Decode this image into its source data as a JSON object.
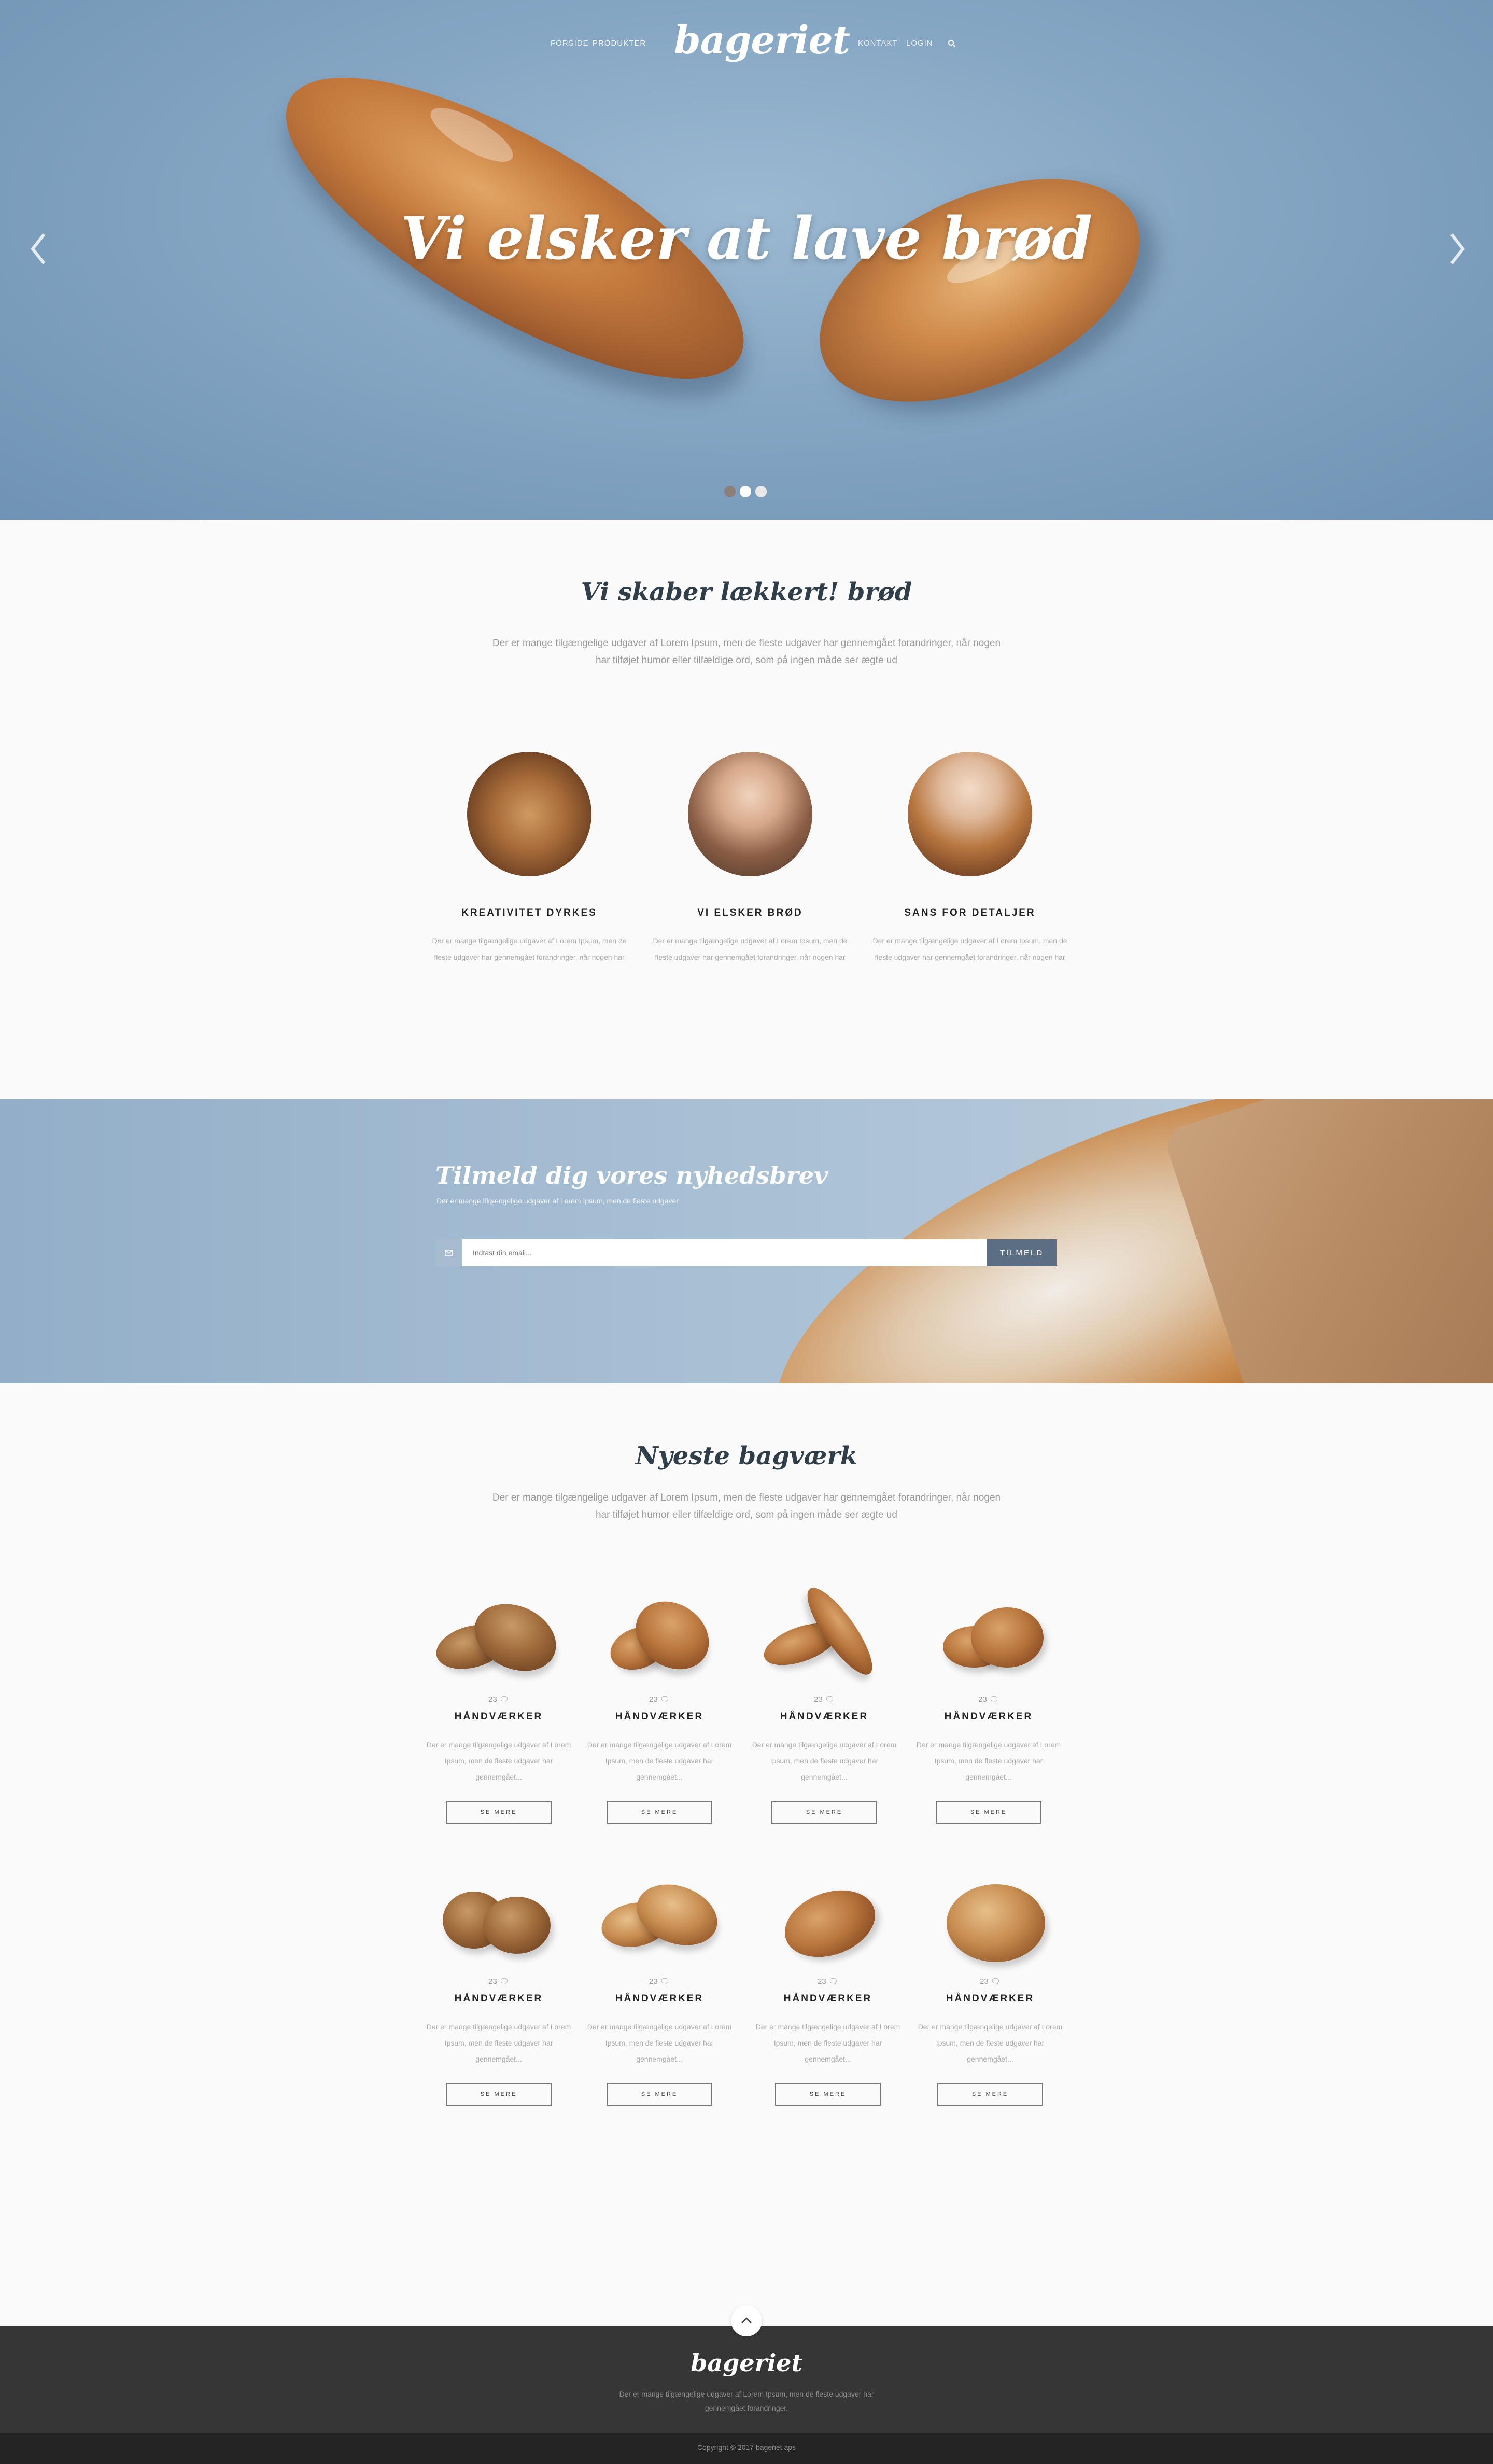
{
  "nav": {
    "left_items": [
      "FORSIDE",
      "PRODUKTER"
    ],
    "right_items": [
      "KONTAKT",
      "LOGIN"
    ],
    "active_item": "PRODUKTER",
    "logo": "bageriet",
    "search_icon": "search-icon"
  },
  "hero": {
    "title": "Vi elsker at lave brød",
    "slides_count": 3,
    "active_slide": 1,
    "prev_icon": "chevron-left-icon",
    "next_icon": "chevron-right-icon"
  },
  "about": {
    "title": "Vi skaber lækkert! brød",
    "lead": "Der er mange tilgængelige udgaver af Lorem Ipsum, men de fleste udgaver har gennemgået forandringer, når nogen har tilføjet humor eller tilfældige ord, som på ingen måde ser ægte ud",
    "features": [
      {
        "title": "KREATIVITET DYRKES",
        "text": "Der er mange tilgængelige udgaver af Lorem Ipsum, men de fleste udgaver har gennemgået forandringer, når nogen har"
      },
      {
        "title": "VI ELSKER BRØD",
        "text": "Der er mange tilgængelige udgaver af Lorem Ipsum, men de fleste udgaver har gennemgået forandringer, når nogen har"
      },
      {
        "title": "SANS FOR DETALJER",
        "text": "Der er mange tilgængelige udgaver af Lorem Ipsum, men de fleste udgaver har gennemgået forandringer, når nogen har"
      }
    ]
  },
  "newsletter": {
    "title": "Tilmeld dig vores nyhedsbrev",
    "subtitle": "Der er mange tilgængelige udgaver af Lorem Ipsum, men de fleste udgaver",
    "placeholder": "Indtast din email...",
    "button": "TILMELD",
    "icon": "mail-icon"
  },
  "products": {
    "title": "Nyeste bagværk",
    "lead": "Der er mange tilgængelige udgaver af Lorem Ipsum, men de fleste udgaver har gennemgået forandringer, når nogen har tilføjet humor eller tilfældige ord, som på ingen måde ser ægte ud",
    "comment_icon": "comment-icon",
    "items": [
      {
        "comments": "23",
        "title": "HÅNDVÆRKER",
        "text": "Der er mange tilgængelige udgaver af Lorem Ipsum, men de fleste udgaver har gennemgået...",
        "button": "SE MERE"
      },
      {
        "comments": "23",
        "title": "HÅNDVÆRKER",
        "text": "Der er mange tilgængelige udgaver af Lorem Ipsum, men de fleste udgaver har gennemgået...",
        "button": "SE MERE"
      },
      {
        "comments": "23",
        "title": "HÅNDVÆRKER",
        "text": "Der er mange tilgængelige udgaver af Lorem Ipsum, men de fleste udgaver har gennemgået...",
        "button": "SE MERE"
      },
      {
        "comments": "23",
        "title": "HÅNDVÆRKER",
        "text": "Der er mange tilgængelige udgaver af Lorem Ipsum, men de fleste udgaver har gennemgået...",
        "button": "SE MERE"
      },
      {
        "comments": "23",
        "title": "HÅNDVÆRKER",
        "text": "Der er mange tilgængelige udgaver af Lorem Ipsum, men de fleste udgaver har gennemgået...",
        "button": "SE MERE"
      },
      {
        "comments": "23",
        "title": "HÅNDVÆRKER",
        "text": "Der er mange tilgængelige udgaver af Lorem Ipsum, men de fleste udgaver har gennemgået...",
        "button": "SE MERE"
      },
      {
        "comments": "23",
        "title": "HÅNDVÆRKER",
        "text": "Der er mange tilgængelige udgaver af Lorem Ipsum, men de fleste udgaver har gennemgået...",
        "button": "SE MERE"
      },
      {
        "comments": "23",
        "title": "HÅNDVÆRKER",
        "text": "Der er mange tilgængelige udgaver af Lorem Ipsum, men de fleste udgaver har gennemgået...",
        "button": "SE MERE"
      }
    ]
  },
  "footer": {
    "logo": "bageriet",
    "text": "Der er mange tilgængelige udgaver af Lorem Ipsum, men de fleste udgaver har gennemgået forandringer.",
    "copyright": "Copyright © 2017 bageriet aps",
    "to_top_icon": "chevron-up-icon"
  },
  "colors": {
    "hero_bg": "#85a6c3",
    "heading": "#2f3e48",
    "button_dark": "#5c6f82",
    "footer_bg": "#363636",
    "copyright_bg": "#242424"
  }
}
